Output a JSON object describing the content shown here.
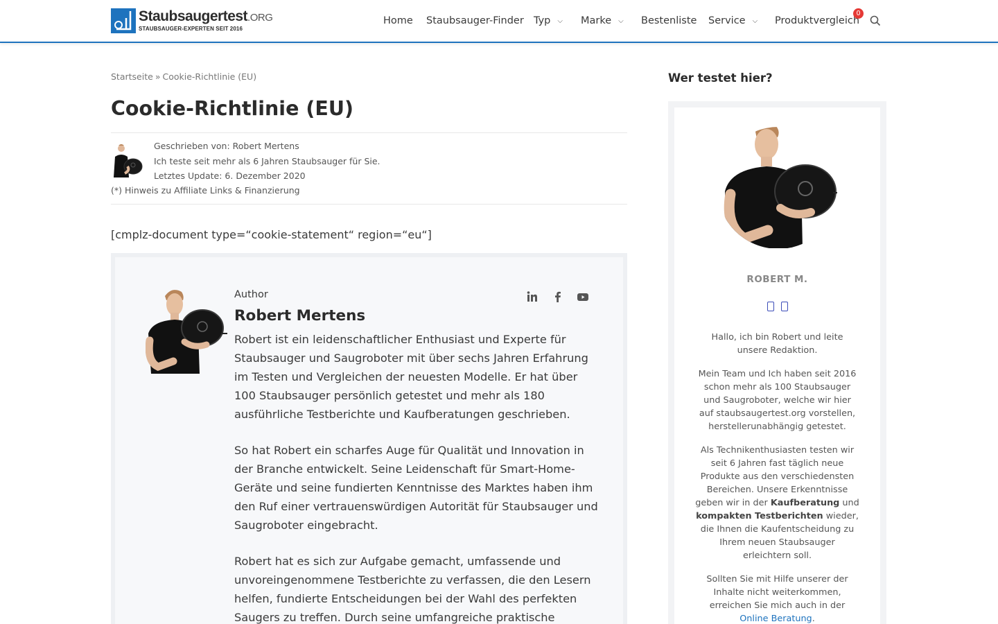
{
  "header": {
    "logo_title": "Staubsaugertest",
    "logo_tld": ".ORG",
    "logo_subtitle": "STAUBSAUGER-EXPERTEN SEIT 2016",
    "brand_color": "#1e73be",
    "nav": [
      {
        "label": "Home"
      },
      {
        "label": "Staubsauger-Finder"
      },
      {
        "label": "Typ"
      },
      {
        "label": "Marke"
      },
      {
        "label": "Bestenliste"
      },
      {
        "label": "Service"
      },
      {
        "label": "Produktvergleich"
      }
    ],
    "cart_count": "0",
    "badge_color": "#e53935"
  },
  "breadcrumb": {
    "home": "Startseite",
    "separator": "»",
    "current": "Cookie-Richtlinie (EU)"
  },
  "page_title": "Cookie-Richtlinie (EU)",
  "meta": {
    "written_by": "Geschrieben von: Robert Mertens",
    "tagline": "Ich teste seit mehr als 6 Jahren Staubsauger für Sie.",
    "updated": "Letztes Update: 6. Dezember 2020",
    "affiliate": "(*) Hinweis zu Affiliate Links & Finanzierung"
  },
  "shortcode": "[cmplz-document type=“cookie-statement“ region=“eu“]",
  "author_box": {
    "label": "Author",
    "name": "Robert Mertens",
    "bio": [
      "Robert ist ein leidenschaftlicher Enthusiast und Experte für Staubsauger und Saugroboter mit über sechs Jahren Erfahrung im Testen und Vergleichen der neuesten Modelle. Er hat über 100 Staubsauger persönlich getestet und mehr als 180 ausführliche Testberichte und Kaufberatungen geschrieben.",
      "So hat Robert ein scharfes Auge für Qualität und Innovation in der Branche entwickelt. Seine Leidenschaft für Smart-Home-Geräte und seine fundierten Kenntnisse des Marktes haben ihm den Ruf einer vertrauenswürdigen Autorität für Staubsauger und Saugroboter eingebracht.",
      "Robert hat es sich zur Aufgabe gemacht, umfassende und unvoreingenommene Testberichte zu verfassen, die den Lesern helfen, fundierte Entscheidungen bei der Wahl des perfekten Saugers zu treffen. Durch seine umfangreiche praktische"
    ],
    "socials": [
      "linkedin-icon",
      "facebook-icon",
      "youtube-icon"
    ]
  },
  "sidebar": {
    "title": "Wer testet hier?",
    "name": "ROBERT M.",
    "p1": "Hallo, ich bin Robert und leite unsere Redaktion.",
    "p2": "Mein Team und Ich haben seit 2016 schon mehr als 100 Staubsauger und Saugroboter, welche wir hier auf staubsaugertest.org vorstellen, herstellerunabhängig getestet.",
    "p3_a": "Als Technikenthusiasten testen wir seit 6 Jahren fast täglich neue Produkte aus den verschiedensten Bereichen. Unsere Erkenntnisse geben wir in der ",
    "p3_b1": "Kaufberatung",
    "p3_c": " und ",
    "p3_b2": "kompakten Testberichten",
    "p3_d": " wieder, die Ihnen die Kaufentscheidung zu Ihrem neuen Staubsauger erleichtern soll.",
    "p4_a": "Sollten Sie mit Hilfe unserer der Inhalte nicht weiterkommen, erreichen Sie mich auch in der ",
    "p4_link": "Online Beratung",
    "p4_b": "."
  }
}
